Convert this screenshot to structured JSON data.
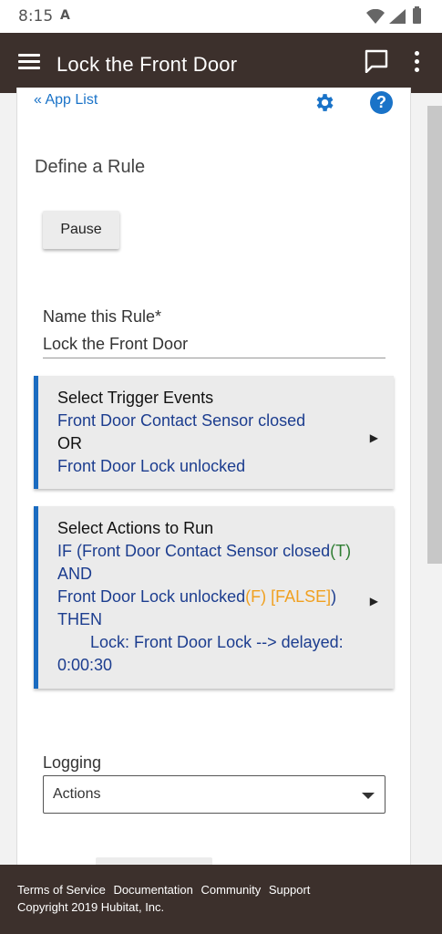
{
  "status_bar": {
    "time": "8:15",
    "notification_letter": "A"
  },
  "app_bar": {
    "title": "Lock the Front Door"
  },
  "card": {
    "app_list_link": "« App List",
    "heading": "Define a Rule",
    "pause_label": "Pause",
    "name_label": "Name this Rule*",
    "name_value": "Lock the Front Door"
  },
  "triggers": {
    "heading": "Select Trigger Events",
    "line1": "Front Door Contact Sensor closed",
    "line2": "OR",
    "line3": "Front Door Lock unlocked"
  },
  "actions": {
    "heading": "Select Actions to Run",
    "if_text": "IF (Front Door Contact Sensor closed",
    "if_state": "(T)",
    "and": "AND",
    "lock_text": "Front Door Lock unlocked",
    "lock_state": "(F) [FALSE]",
    "lock_close": ")",
    "then": "THEN",
    "action_line1": "Lock: Front Door Lock --> delayed:",
    "action_line2": "0:00:30"
  },
  "logging": {
    "label": "Logging",
    "selected": "Actions"
  },
  "footer": {
    "links": [
      "Terms of Service",
      "Documentation",
      "Community",
      "Support"
    ],
    "copyright": "Copyright 2019 Hubitat, Inc."
  },
  "colors": {
    "app_bar": "#3c302c",
    "link_blue": "#1a73c8",
    "section_accent": "#1a6bc0",
    "true_green": "#2e7d32",
    "false_orange": "#f0a020"
  }
}
